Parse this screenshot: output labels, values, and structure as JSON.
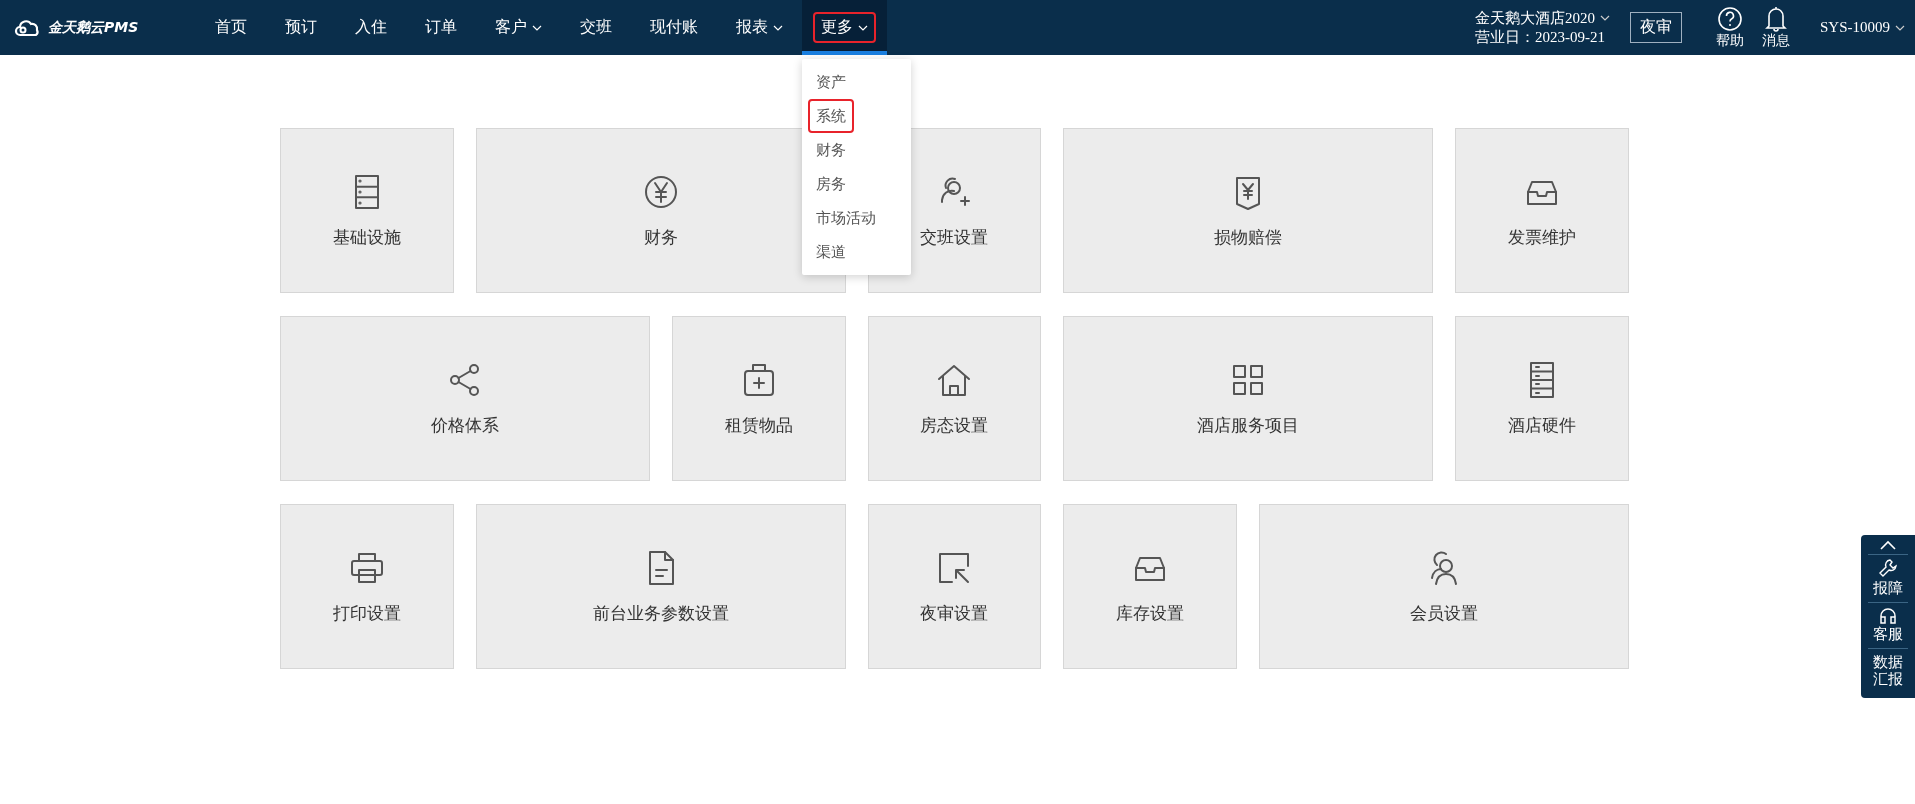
{
  "header": {
    "logo": "金天鹅云PMS",
    "nav": [
      {
        "label": "首页",
        "caret": false,
        "selected": false,
        "highlighted": false
      },
      {
        "label": "预订",
        "caret": false,
        "selected": false,
        "highlighted": false
      },
      {
        "label": "入住",
        "caret": false,
        "selected": false,
        "highlighted": false
      },
      {
        "label": "订单",
        "caret": false,
        "selected": false,
        "highlighted": false
      },
      {
        "label": "客户",
        "caret": true,
        "selected": false,
        "highlighted": false
      },
      {
        "label": "交班",
        "caret": false,
        "selected": false,
        "highlighted": false
      },
      {
        "label": "现付账",
        "caret": false,
        "selected": false,
        "highlighted": false
      },
      {
        "label": "报表",
        "caret": true,
        "selected": false,
        "highlighted": false
      },
      {
        "label": "更多",
        "caret": true,
        "selected": true,
        "highlighted": true
      }
    ],
    "hotel": "金天鹅大酒店2020",
    "business_day": "营业日：2023-09-21",
    "night_audit_button": "夜审",
    "help": "帮助",
    "messages": "消息",
    "user": "SYS-10009"
  },
  "dropdown": [
    {
      "label": "资产",
      "highlighted": false
    },
    {
      "label": "系统",
      "highlighted": true
    },
    {
      "label": "财务",
      "highlighted": false
    },
    {
      "label": "房务",
      "highlighted": false
    },
    {
      "label": "市场活动",
      "highlighted": false
    },
    {
      "label": "渠道",
      "highlighted": false
    }
  ],
  "tiles": [
    {
      "label": "基础设施",
      "kind": "normal"
    },
    {
      "label": "财务",
      "kind": "wide"
    },
    {
      "label": "交班设置",
      "kind": "normal"
    },
    {
      "label": "损物赔偿",
      "kind": "wide"
    },
    {
      "label": "发票维护",
      "kind": "normal"
    },
    {
      "label": "价格体系",
      "kind": "wide"
    },
    {
      "label": "租赁物品",
      "kind": "normal"
    },
    {
      "label": "房态设置",
      "kind": "normal"
    },
    {
      "label": "酒店服务项目",
      "kind": "wide"
    },
    {
      "label": "酒店硬件",
      "kind": "normal"
    },
    {
      "label": "打印设置",
      "kind": "normal"
    },
    {
      "label": "前台业务参数设置",
      "kind": "wide"
    },
    {
      "label": "夜审设置",
      "kind": "normal"
    },
    {
      "label": "库存设置",
      "kind": "normal"
    },
    {
      "label": "会员设置",
      "kind": "wide"
    }
  ],
  "side_panel": {
    "report_issue": "报障",
    "support": "客服",
    "data_report": "数据汇报"
  }
}
